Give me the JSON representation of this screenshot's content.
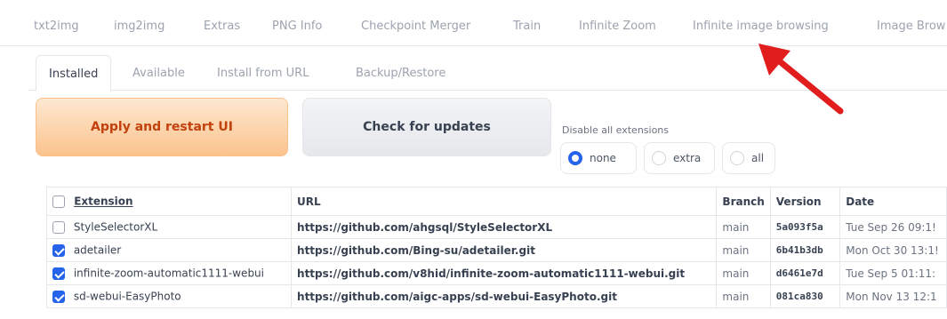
{
  "top_tabs": [
    "txt2img",
    "img2img",
    "Extras",
    "PNG Info",
    "Checkpoint Merger",
    "Train",
    "Infinite Zoom",
    "Infinite image browsing",
    "Image Brow"
  ],
  "sub_tabs": [
    "Installed",
    "Available",
    "Install from URL",
    "Backup/Restore"
  ],
  "buttons": {
    "apply": "Apply and restart UI",
    "check": "Check for updates"
  },
  "disable": {
    "label": "Disable all extensions",
    "options": [
      "none",
      "extra",
      "all"
    ],
    "selected": "none"
  },
  "colors": {
    "accent": "#2563eb",
    "apply_bg": "#fbc38d",
    "arrow": "#e11d1d"
  },
  "table": {
    "headers": [
      "Extension",
      "URL",
      "Branch",
      "Version",
      "Date"
    ],
    "rows": [
      {
        "name": "StyleSelectorXL",
        "checked": false,
        "url": "https://github.com/ahgsql/StyleSelectorXL",
        "branch": "main",
        "version": "5a093f5a",
        "date": "Tue Sep 26 09:1!"
      },
      {
        "name": "adetailer",
        "checked": true,
        "url": "https://github.com/Bing-su/adetailer.git",
        "branch": "main",
        "version": "6b41b3db",
        "date": "Mon Oct 30 13:1!"
      },
      {
        "name": "infinite-zoom-automatic1111-webui",
        "checked": true,
        "url": "https://github.com/v8hid/infinite-zoom-automatic1111-webui.git",
        "branch": "main",
        "version": "d6461e7d",
        "date": "Tue Sep 5 01:11:"
      },
      {
        "name": "sd-webui-EasyPhoto",
        "checked": true,
        "url": "https://github.com/aigc-apps/sd-webui-EasyPhoto.git",
        "branch": "main",
        "version": "081ca830",
        "date": "Mon Nov 13 12:1"
      }
    ]
  }
}
